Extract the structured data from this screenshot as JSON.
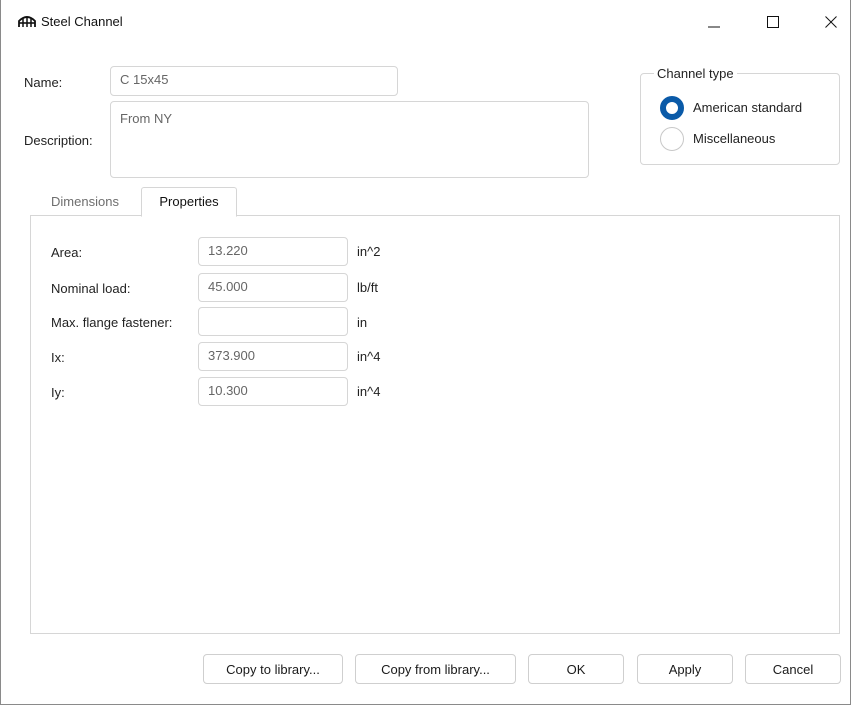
{
  "window": {
    "title": "Steel Channel",
    "icon": "bridge-icon",
    "controls": {
      "minimize": "—",
      "maximize": "☐",
      "close": "✕"
    }
  },
  "form": {
    "name_label": "Name:",
    "name_value": "C 15x45",
    "description_label": "Description:",
    "description_value": "From NY"
  },
  "channel_type": {
    "title": "Channel type",
    "options": [
      {
        "label": "American standard",
        "selected": true
      },
      {
        "label": "Miscellaneous",
        "selected": false
      }
    ]
  },
  "tabs": [
    {
      "label": "Dimensions",
      "active": false
    },
    {
      "label": "Properties",
      "active": true
    }
  ],
  "properties": [
    {
      "label": "Area:",
      "value": "13.220",
      "unit": "in^2"
    },
    {
      "label": "Nominal load:",
      "value": "45.000",
      "unit": "lb/ft"
    },
    {
      "label": "Max. flange fastener:",
      "value": "",
      "unit": "in"
    },
    {
      "label": "Ix:",
      "value": "373.900",
      "unit": "in^4"
    },
    {
      "label": "Iy:",
      "value": "10.300",
      "unit": "in^4"
    }
  ],
  "buttons": {
    "copy_to_library": "Copy to library...",
    "copy_from_library": "Copy from library...",
    "ok": "OK",
    "apply": "Apply",
    "cancel": "Cancel"
  },
  "colors": {
    "accent": "#0a5aa8",
    "border": "#d6d6d6",
    "muted_text": "#6e6e6e"
  }
}
